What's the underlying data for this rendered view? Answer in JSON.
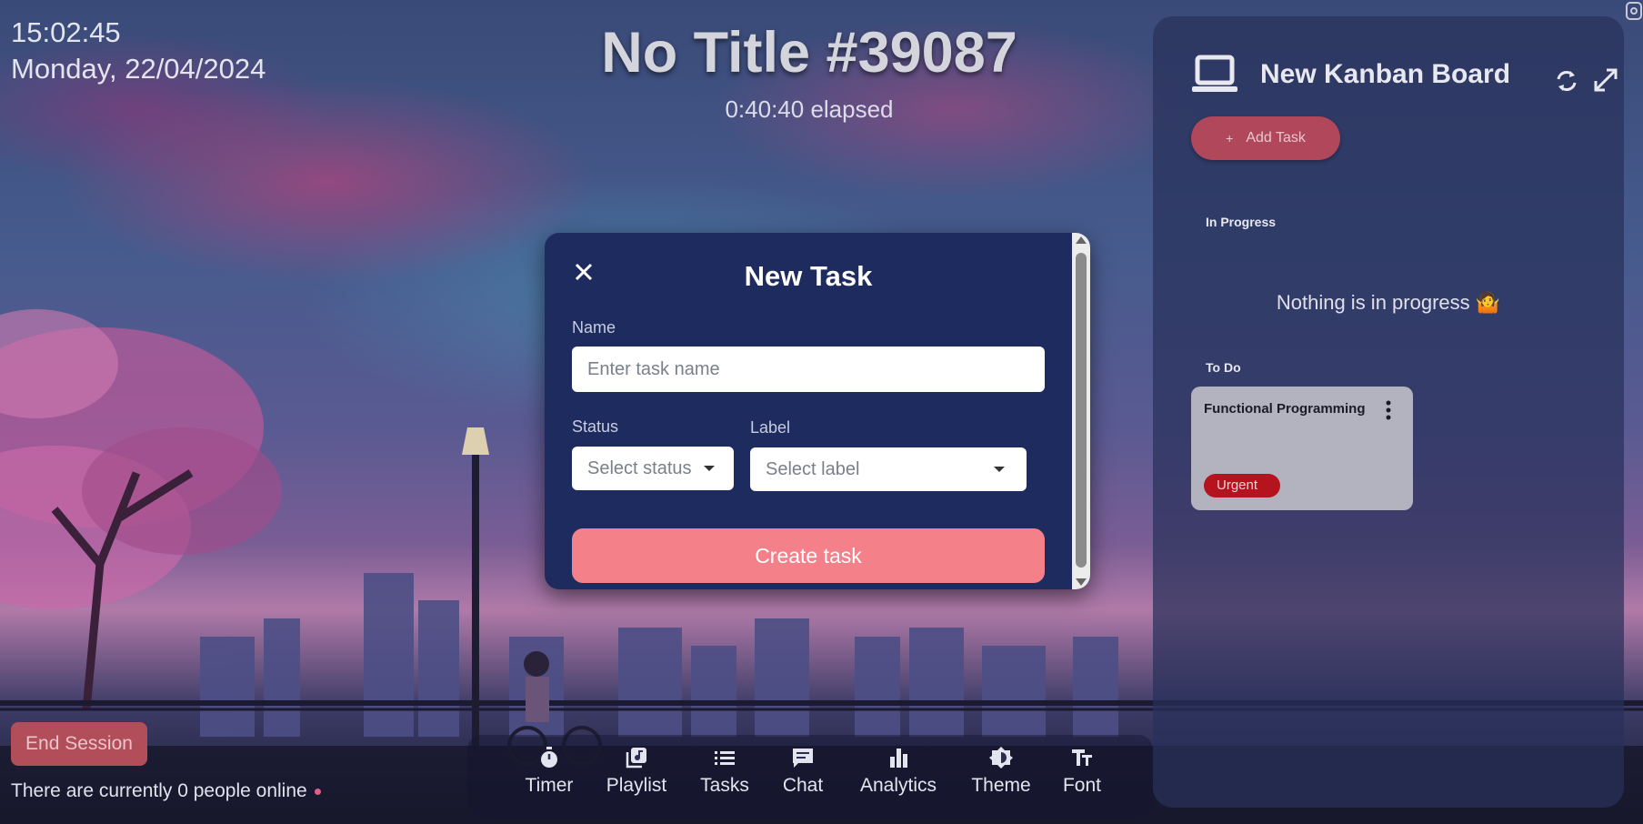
{
  "clock": {
    "time": "15:02:45",
    "date": "Monday, 22/04/2024"
  },
  "session": {
    "title": "No Title #39087",
    "elapsed": "0:40:40 elapsed"
  },
  "kanban": {
    "title": "New Kanban Board",
    "add_task_label": "Add Task",
    "sections": {
      "in_progress": "In Progress",
      "in_progress_empty": "Nothing is in progress 🤷",
      "to_do": "To Do"
    },
    "cards": [
      {
        "title": "Functional Programming",
        "label": "Urgent"
      }
    ],
    "icons": [
      "laptop-icon",
      "refresh-icon",
      "expand-icon",
      "more-vertical-icon"
    ]
  },
  "modal": {
    "title": "New Task",
    "name_label": "Name",
    "name_placeholder": "Enter task name",
    "status_label": "Status",
    "status_placeholder": "Select status",
    "label_label": "Label",
    "label_placeholder": "Select label",
    "create_button": "Create task"
  },
  "footer": {
    "end_session": "End Session",
    "online_text": "There are currently 0 people online"
  },
  "toolbar": {
    "items": [
      {
        "label": "Timer",
        "icon": "stopwatch-icon"
      },
      {
        "label": "Playlist",
        "icon": "playlist-icon"
      },
      {
        "label": "Tasks",
        "icon": "list-icon"
      },
      {
        "label": "Chat",
        "icon": "chat-icon"
      },
      {
        "label": "Analytics",
        "icon": "bar-chart-icon"
      },
      {
        "label": "Theme",
        "icon": "theme-icon"
      },
      {
        "label": "Font",
        "icon": "font-icon"
      }
    ]
  },
  "colors": {
    "accent": "#f4808a",
    "add_task": "#b0475b",
    "urgent": "#b5141e",
    "modal_bg": "#1d2b5e",
    "panel_bg": "#28305a"
  }
}
